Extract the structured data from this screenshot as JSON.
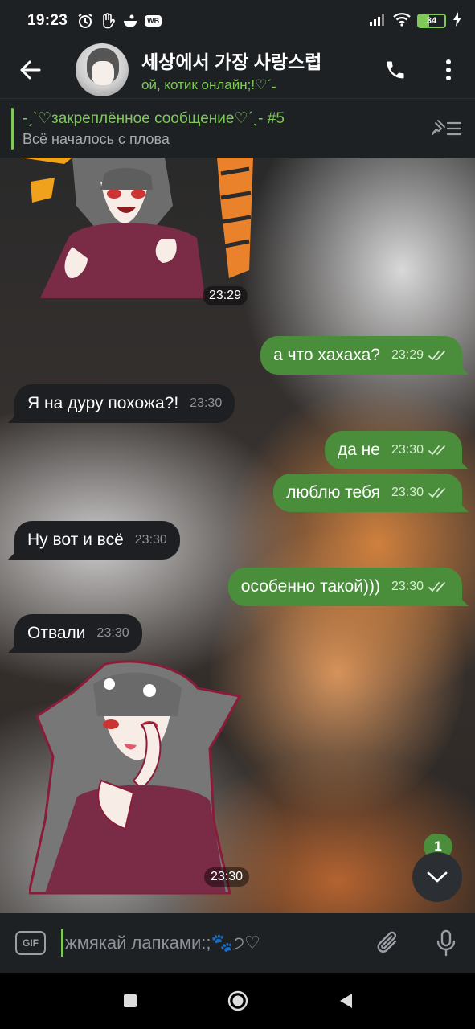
{
  "status_bar": {
    "time": "19:23",
    "battery": "34",
    "icons_left": [
      "alarm-icon",
      "hand-icon",
      "bowl-icon",
      "wb-icon"
    ],
    "wb_label": "WB",
    "icons_right": [
      "signal-icon",
      "wifi-icon",
      "battery-icon",
      "charging-icon"
    ]
  },
  "header": {
    "title": "세상에서 가장 사랑스럽",
    "subtitle": "ой, котик онлайн;!♡ˊ˗"
  },
  "pinned": {
    "title": "-ˏˋ♡закреплённое сообщение♡ˊˎ- #5",
    "preview": "Всё началось с плова"
  },
  "messages": [
    {
      "type": "sticker",
      "direction": "in",
      "time": "23:29"
    },
    {
      "type": "text",
      "direction": "out",
      "text": "а что хахаха?",
      "time": "23:29",
      "read": true
    },
    {
      "type": "text",
      "direction": "in",
      "text": "Я на дуру похожа?!",
      "time": "23:30"
    },
    {
      "type": "text",
      "direction": "out",
      "text": "да не",
      "time": "23:30",
      "read": true
    },
    {
      "type": "text",
      "direction": "out",
      "text": "люблю тебя",
      "time": "23:30",
      "read": true
    },
    {
      "type": "text",
      "direction": "in",
      "text": "Ну вот и всё",
      "time": "23:30"
    },
    {
      "type": "text",
      "direction": "out",
      "text": "особенно такой)))",
      "time": "23:30",
      "read": true
    },
    {
      "type": "text",
      "direction": "in",
      "text": "Отвали",
      "time": "23:30"
    },
    {
      "type": "sticker",
      "direction": "in",
      "time": "23:30"
    }
  ],
  "scroll": {
    "unread_count": "1"
  },
  "composer": {
    "placeholder": "жмякай лапками:;🐾੭♡"
  },
  "colors": {
    "accent": "#7ec957",
    "outgoing_bubble": "#4a8e3c",
    "incoming_bubble": "#1d1f22",
    "bar_bg": "#1e2124"
  }
}
